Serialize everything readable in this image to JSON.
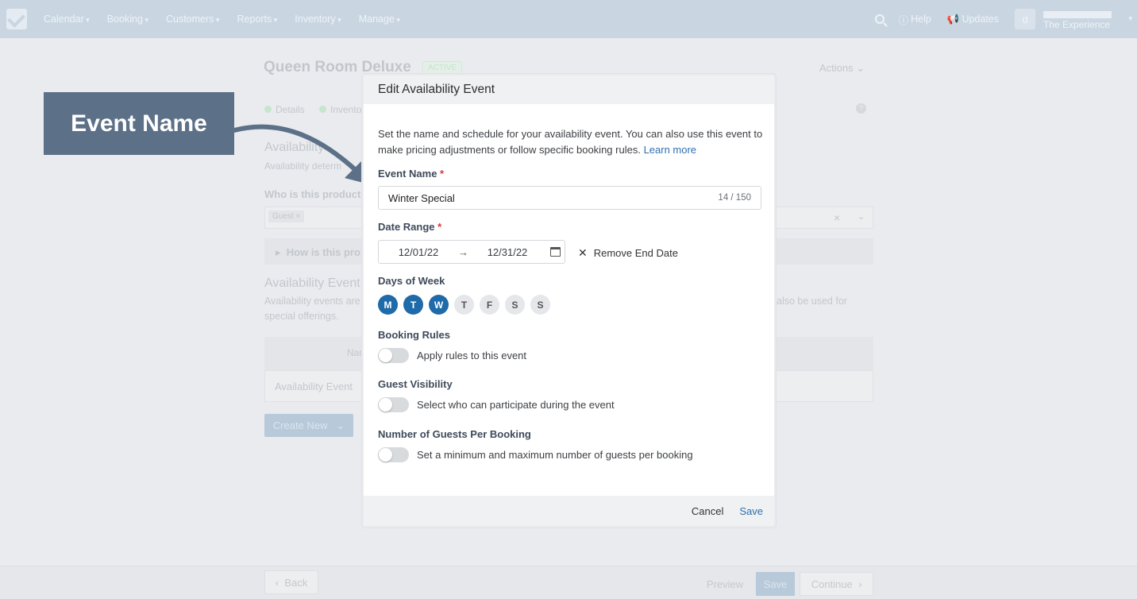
{
  "nav": {
    "items": [
      "Calendar",
      "Booking",
      "Customers",
      "Reports",
      "Inventory",
      "Manage"
    ],
    "help": "Help",
    "updates": "Updates",
    "avatar_letter": "d",
    "account_name": "The Experience"
  },
  "background": {
    "product_title": "Queen Room Deluxe",
    "status_badge": "ACTIVE",
    "actions": "Actions",
    "tab_details": "Details",
    "tab_inventory": "Inventory",
    "section_title": "Availability",
    "section_sub": "Availability determ",
    "who_label": "Who is this product",
    "guest_tag": "Guest",
    "how_label": "How is this pro",
    "events_title": "Availability Event",
    "events_sub1": "Availability events are",
    "events_sub2": "special offerings.",
    "events_sub_right": "also be used for",
    "table_header": "Nam",
    "table_row": "Availability Event",
    "create_new": "Create New",
    "back": "Back",
    "preview": "Preview",
    "save": "Save",
    "continue": "Continue"
  },
  "annotation": {
    "label": "Event Name"
  },
  "modal": {
    "title": "Edit Availability Event",
    "description": "Set the name and schedule for your availability event. You can also use this event to make pricing adjustments or follow specific booking rules.",
    "learn_more": "Learn more",
    "event_name_label": "Event Name",
    "required_mark": "*",
    "event_name_value": "Winter Special",
    "event_name_count": "14 / 150",
    "date_range_label": "Date Range",
    "start_date": "12/01/22",
    "end_date": "12/31/22",
    "remove_end_date": "Remove End Date",
    "days_label": "Days of Week",
    "days": [
      {
        "letter": "M",
        "selected": true
      },
      {
        "letter": "T",
        "selected": true
      },
      {
        "letter": "W",
        "selected": true
      },
      {
        "letter": "T",
        "selected": false
      },
      {
        "letter": "F",
        "selected": false
      },
      {
        "letter": "S",
        "selected": false
      },
      {
        "letter": "S",
        "selected": false
      }
    ],
    "booking_rules_label": "Booking Rules",
    "booking_rules_text": "Apply rules to this event",
    "guest_visibility_label": "Guest Visibility",
    "guest_visibility_text": "Select who can participate during the event",
    "guests_per_booking_label": "Number of Guests Per Booking",
    "guests_per_booking_text": "Set a minimum and maximum number of guests per booking",
    "cancel": "Cancel",
    "save": "Save"
  },
  "colors": {
    "primary": "#1f6aa9",
    "link": "#2f6fb0",
    "required": "#d9363e",
    "annotation_bg": "#5c7088"
  }
}
